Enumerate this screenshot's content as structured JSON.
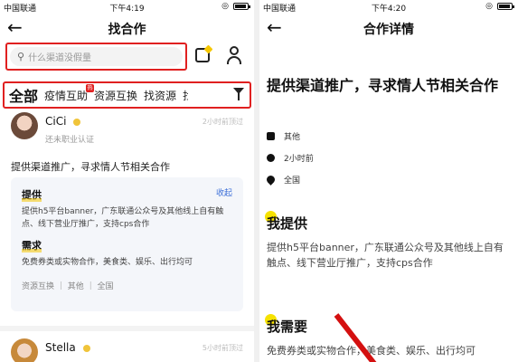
{
  "left": {
    "status": {
      "carrier": "中国联通",
      "time": "下午4:19"
    },
    "title": "找合作",
    "search": {
      "placeholder": "什么渠道没假量"
    },
    "tabs": [
      "全部",
      "疫情互助",
      "资源互换",
      "找资源",
      "找"
    ],
    "hot_badge": "热",
    "post1": {
      "name": "CiCi",
      "sub": "还未职业认证",
      "time": "2小时前顶过",
      "title": "提供渠道推广，寻求情人节相关合作",
      "offer_h": "提供",
      "collapse": "收起",
      "offer_text": "提供h5平台banner，广东联通公众号及其他线上自有触点、线下营业厅推广，支持cps合作",
      "need_h": "需求",
      "need_text": "免费券类或实物合作，美食类、娱乐、出行均可",
      "tags": "资源互换 ｜ 其他 ｜ 全国"
    },
    "post2": {
      "name": "Stella",
      "time": "5小时前顶过"
    }
  },
  "right": {
    "status": {
      "carrier": "中国联通",
      "time": "下午4:20"
    },
    "title": "合作详情",
    "detail_title": "提供渠道推广，寻求情人节相关合作",
    "meta": {
      "type": "其他",
      "time": "2小时前",
      "region": "全国"
    },
    "offer_h": "我提供",
    "offer_text": "提供h5平台banner，广东联通公众号及其他线上自有触点、线下营业厅推广，支持cps合作",
    "need_h": "我需要",
    "need_text": "免费券类或实物合作，美食类、娱乐、出行均可"
  },
  "battery_level": 0.9,
  "colors": {
    "highlight_box": "#e02020",
    "accent": "#f6c700",
    "link": "#3c6fd8"
  }
}
